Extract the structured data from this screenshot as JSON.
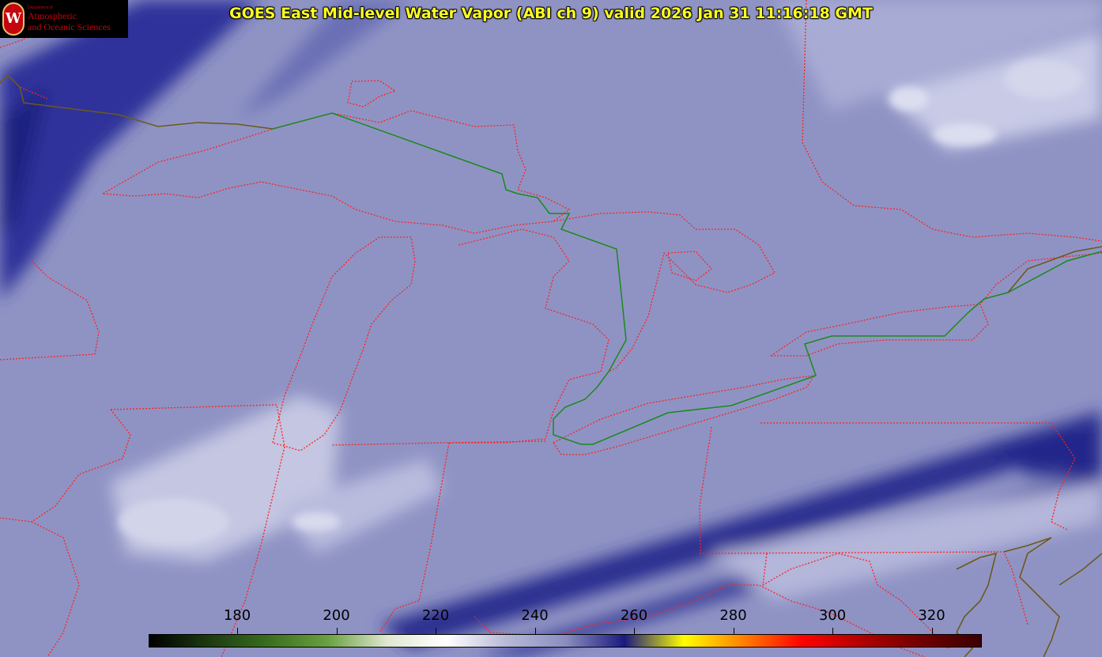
{
  "title": "GOES East Mid-level Water Vapor (ABI ch 9)  valid 2026 Jan 31 11:16:18 GMT",
  "logo": {
    "seal_letter": "W",
    "department": "Department of",
    "line1": "Atmospheric",
    "line2": "and Oceanic Sciences"
  },
  "colorbar": {
    "ticks": [
      "180",
      "200",
      "220",
      "240",
      "260",
      "280",
      "300",
      "320"
    ],
    "gradient": [
      "#000000",
      "#1c3a10",
      "#3a6e1e",
      "#6aa040",
      "#dfe8d0",
      "#ffffff",
      "#b8bad8",
      "#8a8ec0",
      "#1a1a80",
      "#ffff00",
      "#ff8000",
      "#ff0000",
      "#b00000",
      "#700000",
      "#3a0000"
    ]
  },
  "map_colors": {
    "background": "#8f93c4",
    "dry_band": "#2b2f8f",
    "moist_cloud": "#d6d8ec",
    "state_borders": "#ff2020",
    "intl_border": "#1a8a1a",
    "coastline": "#6b5a1a"
  }
}
